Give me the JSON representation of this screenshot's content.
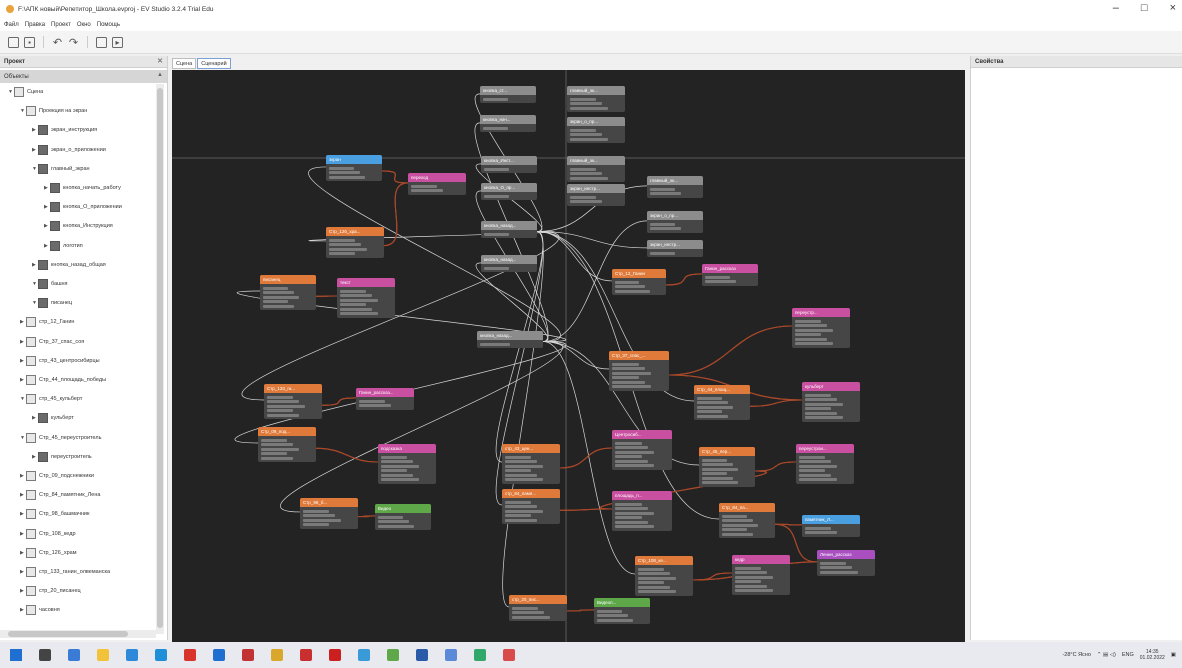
{
  "window": {
    "title": "F:\\АПК новый\\Репетитор_Школа.evproj - EV Studio 3.2.4 Trial Edu",
    "controls": [
      "–",
      "□",
      "×"
    ]
  },
  "menu": [
    "Файл",
    "Правка",
    "Проект",
    "Окно",
    "Помощь"
  ],
  "toolbar_icons": [
    "new-file-icon",
    "save-icon",
    "undo-icon",
    "redo-icon",
    "copy-icon",
    "export-icon"
  ],
  "left_panel": {
    "title": "Проект",
    "section": "Объекты",
    "tree": [
      {
        "label": "Сцена",
        "level": 0,
        "expanded": true
      },
      {
        "label": "Проекция на экран",
        "level": 1,
        "expanded": true
      },
      {
        "label": "экран_инструкция",
        "level": 2,
        "expanded": false
      },
      {
        "label": "экран_о_приложении",
        "level": 2,
        "expanded": false
      },
      {
        "label": "главный_экран",
        "level": 2,
        "expanded": true
      },
      {
        "label": "кнопка_начать_работу",
        "level": 3,
        "expanded": false
      },
      {
        "label": "кнопка_О_приложении",
        "level": 3,
        "expanded": false
      },
      {
        "label": "кнопка_Инструкция",
        "level": 3,
        "expanded": false
      },
      {
        "label": "логотип",
        "level": 3,
        "expanded": false
      },
      {
        "label": "кнопка_назад_общая",
        "level": 2,
        "expanded": false
      },
      {
        "label": "башня",
        "level": 2,
        "expanded": true
      },
      {
        "label": "писанец",
        "level": 2,
        "expanded": true
      },
      {
        "label": "стр_12_Ганин",
        "level": 1,
        "expanded": false
      },
      {
        "label": "Стр_37_спас_соя",
        "level": 1,
        "expanded": false
      },
      {
        "label": "стр_43_центросибирцы",
        "level": 1,
        "expanded": false
      },
      {
        "label": "Стр_44_площадь_победы",
        "level": 1,
        "expanded": false
      },
      {
        "label": "стр_45_кульберт",
        "level": 1,
        "expanded": true
      },
      {
        "label": "кульберт",
        "level": 2,
        "expanded": false
      },
      {
        "label": "Стр_45_переустроитель",
        "level": 1,
        "expanded": true
      },
      {
        "label": "переустроитель",
        "level": 2,
        "expanded": false
      },
      {
        "label": "Стр_09_подснежники",
        "level": 1,
        "expanded": false
      },
      {
        "label": "Стр_84_памятник_Лена",
        "level": 1,
        "expanded": false
      },
      {
        "label": "Стр_98_башмачник",
        "level": 1,
        "expanded": false
      },
      {
        "label": "Стр_108_кедр",
        "level": 1,
        "expanded": false
      },
      {
        "label": "Стр_126_храм",
        "level": 1,
        "expanded": false
      },
      {
        "label": "стр_133_ганин_олвеманска",
        "level": 1,
        "expanded": false
      },
      {
        "label": "стр_20_писанец",
        "level": 1,
        "expanded": false
      },
      {
        "label": "часовня",
        "level": 1,
        "expanded": false
      }
    ]
  },
  "tabs": [
    "Сцена",
    "Сценарий"
  ],
  "active_tab": 1,
  "canvas": {
    "nodes": [
      {
        "title": "кнопка_ст...",
        "color": "#8c8c8c",
        "rows": 1
      },
      {
        "title": "главный_эк...",
        "color": "#8c8c8c",
        "rows": 3
      },
      {
        "title": "кнопка_нач...",
        "color": "#8c8c8c",
        "rows": 1
      },
      {
        "title": "экран_о_пр...",
        "color": "#8c8c8c",
        "rows": 3
      },
      {
        "title": "экран",
        "color": "#4a9fe0",
        "rows": 3
      },
      {
        "title": "переход",
        "color": "#c94fa0",
        "rows": 2
      },
      {
        "title": "кнопка_Инст...",
        "color": "#8c8c8c",
        "rows": 1
      },
      {
        "title": "главный_эк...",
        "color": "#8c8c8c",
        "rows": 3
      },
      {
        "title": "кнопка_О_пр...",
        "color": "#8c8c8c",
        "rows": 1
      },
      {
        "title": "экран_инстр...",
        "color": "#8c8c8c",
        "rows": 2
      },
      {
        "title": "главный_эк...",
        "color": "#8c8c8c",
        "rows": 2
      },
      {
        "title": "экран_о_пр...",
        "color": "#8c8c8c",
        "rows": 2
      },
      {
        "title": "кнопка_назад...",
        "color": "#8c8c8c",
        "rows": 1
      },
      {
        "title": "экран_инстр...",
        "color": "#8c8c8c",
        "rows": 1
      },
      {
        "title": "Стр_126_хра...",
        "color": "#e07a3a",
        "rows": 4
      },
      {
        "title": "кнопка_назад...",
        "color": "#8c8c8c",
        "rows": 1
      },
      {
        "title": "Стр_12_Ганин",
        "color": "#e07a3a",
        "rows": 3
      },
      {
        "title": "Ганин_рассказ",
        "color": "#c94fa0",
        "rows": 2
      },
      {
        "title": "писанец",
        "color": "#e07a3a",
        "rows": 5
      },
      {
        "title": "текст",
        "color": "#c94fa0",
        "rows": 6
      },
      {
        "title": "переустр...",
        "color": "#c94fa0",
        "rows": 6
      },
      {
        "title": "кнопка_назад...",
        "color": "#8c8c8c",
        "rows": 1
      },
      {
        "title": "Стр_37_спас_...",
        "color": "#e07a3a",
        "rows": 6
      },
      {
        "title": "Стр_133_га...",
        "color": "#e07a3a",
        "rows": 5
      },
      {
        "title": "Ганин_рассказ...",
        "color": "#c94fa0",
        "rows": 2
      },
      {
        "title": "Стр_44_площ...",
        "color": "#e07a3a",
        "rows": 5
      },
      {
        "title": "кульберт",
        "color": "#c94fa0",
        "rows": 6
      },
      {
        "title": "Стр_09_под...",
        "color": "#e07a3a",
        "rows": 5
      },
      {
        "title": "подсказка",
        "color": "#c94fa0",
        "rows": 6
      },
      {
        "title": "стр_43_цен...",
        "color": "#e07a3a",
        "rows": 6
      },
      {
        "title": "Центросиб...",
        "color": "#c94fa0",
        "rows": 6
      },
      {
        "title": "Стр_45_пер...",
        "color": "#e07a3a",
        "rows": 6
      },
      {
        "title": "переустрои...",
        "color": "#c94fa0",
        "rows": 6
      },
      {
        "title": "стр_84_памя...",
        "color": "#e07a3a",
        "rows": 5
      },
      {
        "title": "площадь_п...",
        "color": "#c94fa0",
        "rows": 6
      },
      {
        "title": "Стр_98_б...",
        "color": "#e07a3a",
        "rows": 4
      },
      {
        "title": "Видео",
        "color": "#5fa84a",
        "rows": 3
      },
      {
        "title": "Стр_84_па...",
        "color": "#e07a3a",
        "rows": 5
      },
      {
        "title": "памятник_Л...",
        "color": "#4a9fe0",
        "rows": 2
      },
      {
        "title": "Ленин_рассказ",
        "color": "#a94fc0",
        "rows": 3
      },
      {
        "title": "Стр_108_ке...",
        "color": "#e07a3a",
        "rows": 6
      },
      {
        "title": "кедр",
        "color": "#c94fa0",
        "rows": 6
      },
      {
        "title": "стр_20_пис...",
        "color": "#e07a3a",
        "rows": 3
      },
      {
        "title": "Видеоп...",
        "color": "#5fa84a",
        "rows": 3
      }
    ]
  },
  "right_panel": {
    "title": "Свойства"
  },
  "taskbar": {
    "icons": [
      "windows-start-icon",
      "search-icon",
      "task-view-icon",
      "file-explorer-icon",
      "chrome-icon",
      "edge-icon",
      "yandex-icon",
      "app-icon-1",
      "app-icon-2",
      "app-icon-3",
      "app-icon-4",
      "opera-icon",
      "app-icon-5",
      "app-icon-6",
      "app-icon-7",
      "app-icon-8",
      "app-icon-9",
      "app-icon-10"
    ],
    "weather": "-28°C Ясно",
    "lang": "ENG",
    "time": "14:35",
    "date": "01.02.2022"
  }
}
